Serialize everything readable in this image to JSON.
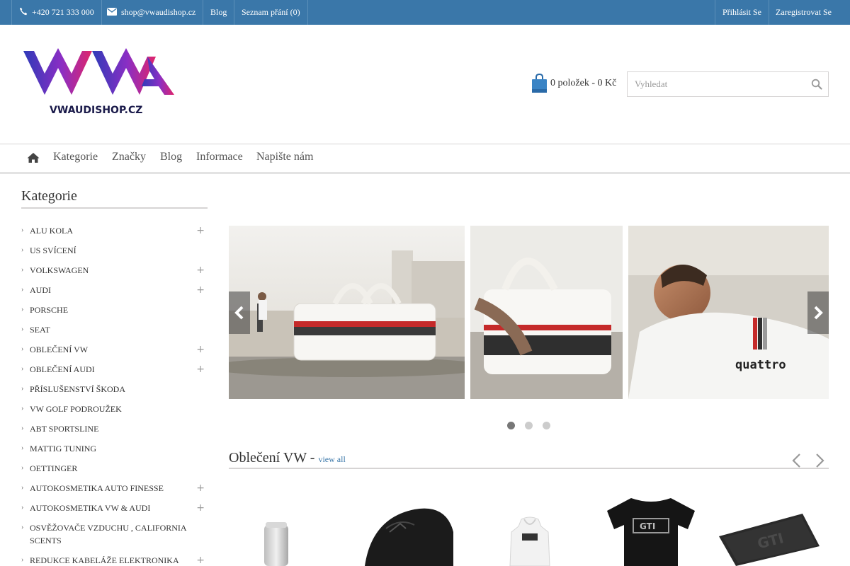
{
  "topbar": {
    "phone": "+420 721 333 000",
    "email": "shop@vwaudishop.cz",
    "blog": "Blog",
    "wishlist": "Seznam přání (0)",
    "login": "Přihlásit Se",
    "register": "Zaregistrovat Se"
  },
  "logo": {
    "wordmark": "VWA",
    "text": "VWAUDISHOP.CZ"
  },
  "cart": {
    "summary": "0 položek - 0 Kč"
  },
  "search": {
    "placeholder": "Vyhledat"
  },
  "nav": {
    "items": [
      {
        "label": "Kategorie"
      },
      {
        "label": "Značky"
      },
      {
        "label": "Blog"
      },
      {
        "label": "Informace"
      },
      {
        "label": "Napište nám"
      }
    ]
  },
  "sidebar": {
    "title": "Kategorie",
    "items": [
      {
        "label": "ALU KOLA",
        "expandable": true
      },
      {
        "label": "US SVÍCENÍ",
        "expandable": false
      },
      {
        "label": "VOLKSWAGEN",
        "expandable": true
      },
      {
        "label": "AUDI",
        "expandable": true
      },
      {
        "label": "PORSCHE",
        "expandable": false
      },
      {
        "label": "SEAT",
        "expandable": false
      },
      {
        "label": "OBLEČENÍ VW",
        "expandable": true
      },
      {
        "label": "OBLEČENÍ AUDI",
        "expandable": true
      },
      {
        "label": "PŘÍSLUŠENSTVÍ ŠKODA",
        "expandable": false
      },
      {
        "label": "VW GOLF PODROUŽEK",
        "expandable": false
      },
      {
        "label": "ABT SPORTSLINE",
        "expandable": false
      },
      {
        "label": "MATTIG TUNING",
        "expandable": false
      },
      {
        "label": "OETTINGER",
        "expandable": false
      },
      {
        "label": "AUTOKOSMETIKA AUTO FINESSE",
        "expandable": true
      },
      {
        "label": "AUTOKOSMETIKA VW & AUDI",
        "expandable": true
      },
      {
        "label": "OSVĚŽOVAČE VZDUCHU , CALIFORNIA SCENTS",
        "expandable": false
      },
      {
        "label": "REDUKCE KABELÁŽE ELEKTRONIKA",
        "expandable": true
      }
    ]
  },
  "slider": {
    "slide_count": 3,
    "active_index": 0,
    "quattro_text": "quattro"
  },
  "section": {
    "title": "Oblečení VW - ",
    "view_all": "view all"
  },
  "products": [
    {
      "icon": "air-freshener-can"
    },
    {
      "icon": "black-cap"
    },
    {
      "icon": "white-hoodie"
    },
    {
      "icon": "black-gti-tshirt",
      "print": "GTI"
    },
    {
      "icon": "gti-floor-mat",
      "print": "GTI"
    }
  ],
  "colors": {
    "topbar": "#3a77a9",
    "accent": "#3a77a9",
    "dot_active": "#777777",
    "dot_inactive": "#cccccc"
  }
}
